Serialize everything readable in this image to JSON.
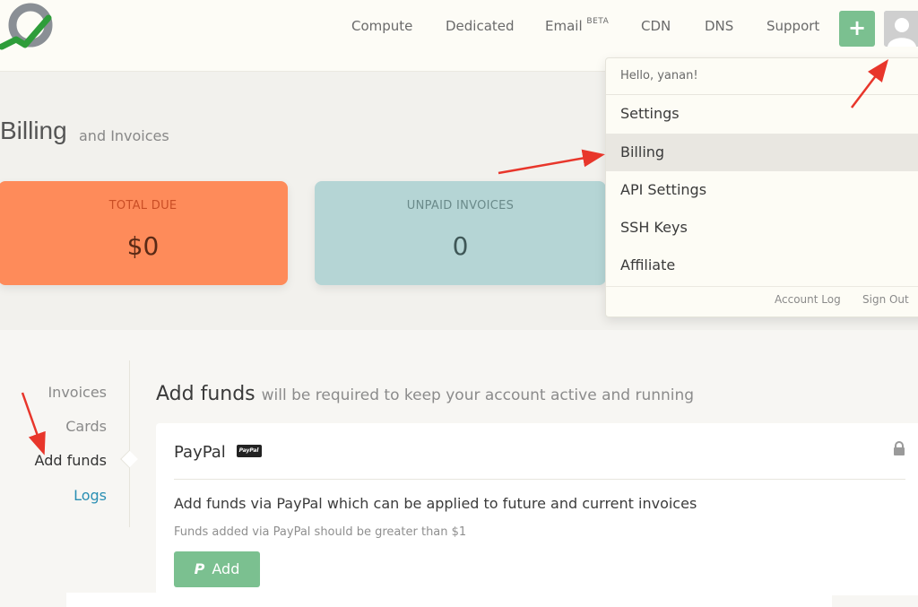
{
  "nav": {
    "items": [
      {
        "label": "Compute"
      },
      {
        "label": "Dedicated"
      },
      {
        "label": "Email",
        "sup": "BETA"
      },
      {
        "label": "CDN"
      },
      {
        "label": "DNS"
      },
      {
        "label": "Support"
      }
    ],
    "plus_label": "+",
    "icons": {
      "logo": "logo-icon",
      "avatar": "user-avatar-icon"
    },
    "colors": {
      "plus_button": "#7bc090"
    }
  },
  "dropdown": {
    "greeting": "Hello, yanan!",
    "items": [
      {
        "label": "Settings"
      },
      {
        "label": "Billing"
      },
      {
        "label": "API Settings"
      },
      {
        "label": "SSH Keys"
      },
      {
        "label": "Affiliate"
      }
    ],
    "footer_links": [
      "Account Log",
      "Sign Out"
    ]
  },
  "page": {
    "title": "Billing",
    "subtitle": "and Invoices"
  },
  "cards": {
    "total_due": {
      "label": "TOTAL DUE",
      "value": "$0",
      "color": "#fe8b5a"
    },
    "unpaid_invoices": {
      "label": "UNPAID INVOICES",
      "value": "0",
      "color": "#b5d5d5"
    }
  },
  "sidenav": {
    "items": [
      {
        "label": "Invoices"
      },
      {
        "label": "Cards"
      },
      {
        "label": "Add funds"
      },
      {
        "label": "Logs"
      }
    ]
  },
  "content": {
    "title": "Add funds",
    "subtitle": "will be required to keep your account active and running",
    "panel": {
      "heading": "PayPal",
      "badge": "PayPal",
      "description": "Add funds via PayPal which can be applied to future and current invoices",
      "note": "Funds added via PayPal should be greater than $1",
      "button_label": "Add",
      "icons": {
        "lock": "lock-icon",
        "paypal": "paypal-icon"
      }
    }
  }
}
